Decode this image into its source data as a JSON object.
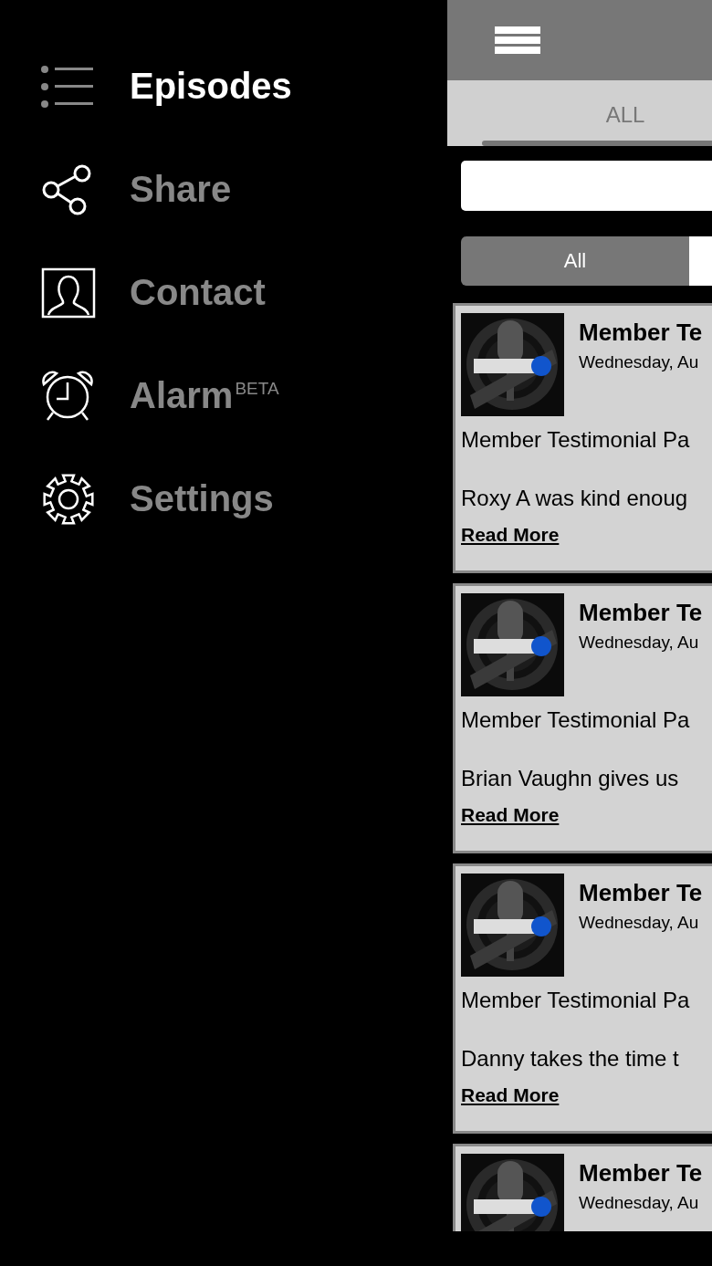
{
  "menu": {
    "items": [
      {
        "kind": "list",
        "label": "Episodes",
        "selected": true
      },
      {
        "kind": "share",
        "label": "Share",
        "selected": false
      },
      {
        "kind": "contact",
        "label": "Contact",
        "selected": false
      },
      {
        "kind": "alarm",
        "label": "Alarm",
        "badge": "BETA",
        "selected": false
      },
      {
        "kind": "settings",
        "label": "Settings",
        "selected": false
      }
    ]
  },
  "tabs": [
    {
      "label": "ALL",
      "selected": true
    }
  ],
  "segments": [
    {
      "label": "All",
      "selected": true
    },
    {
      "selected": false
    }
  ],
  "episodes": [
    {
      "title": "Member Te",
      "date": "Wednesday, Au",
      "summary": "Member Testimonial Pa",
      "excerpt": "Roxy A was kind enoug",
      "link": "Read More"
    },
    {
      "title": "Member Te",
      "date": "Wednesday, Au",
      "summary": "Member Testimonial Pa",
      "excerpt": "Brian Vaughn gives us",
      "link": "Read More"
    },
    {
      "title": "Member Te",
      "date": "Wednesday, Au",
      "summary": "Member Testimonial Pa",
      "excerpt": "Danny takes the time t",
      "link": "Read More"
    },
    {
      "title": "Member Te",
      "date": "Wednesday, Au"
    }
  ]
}
